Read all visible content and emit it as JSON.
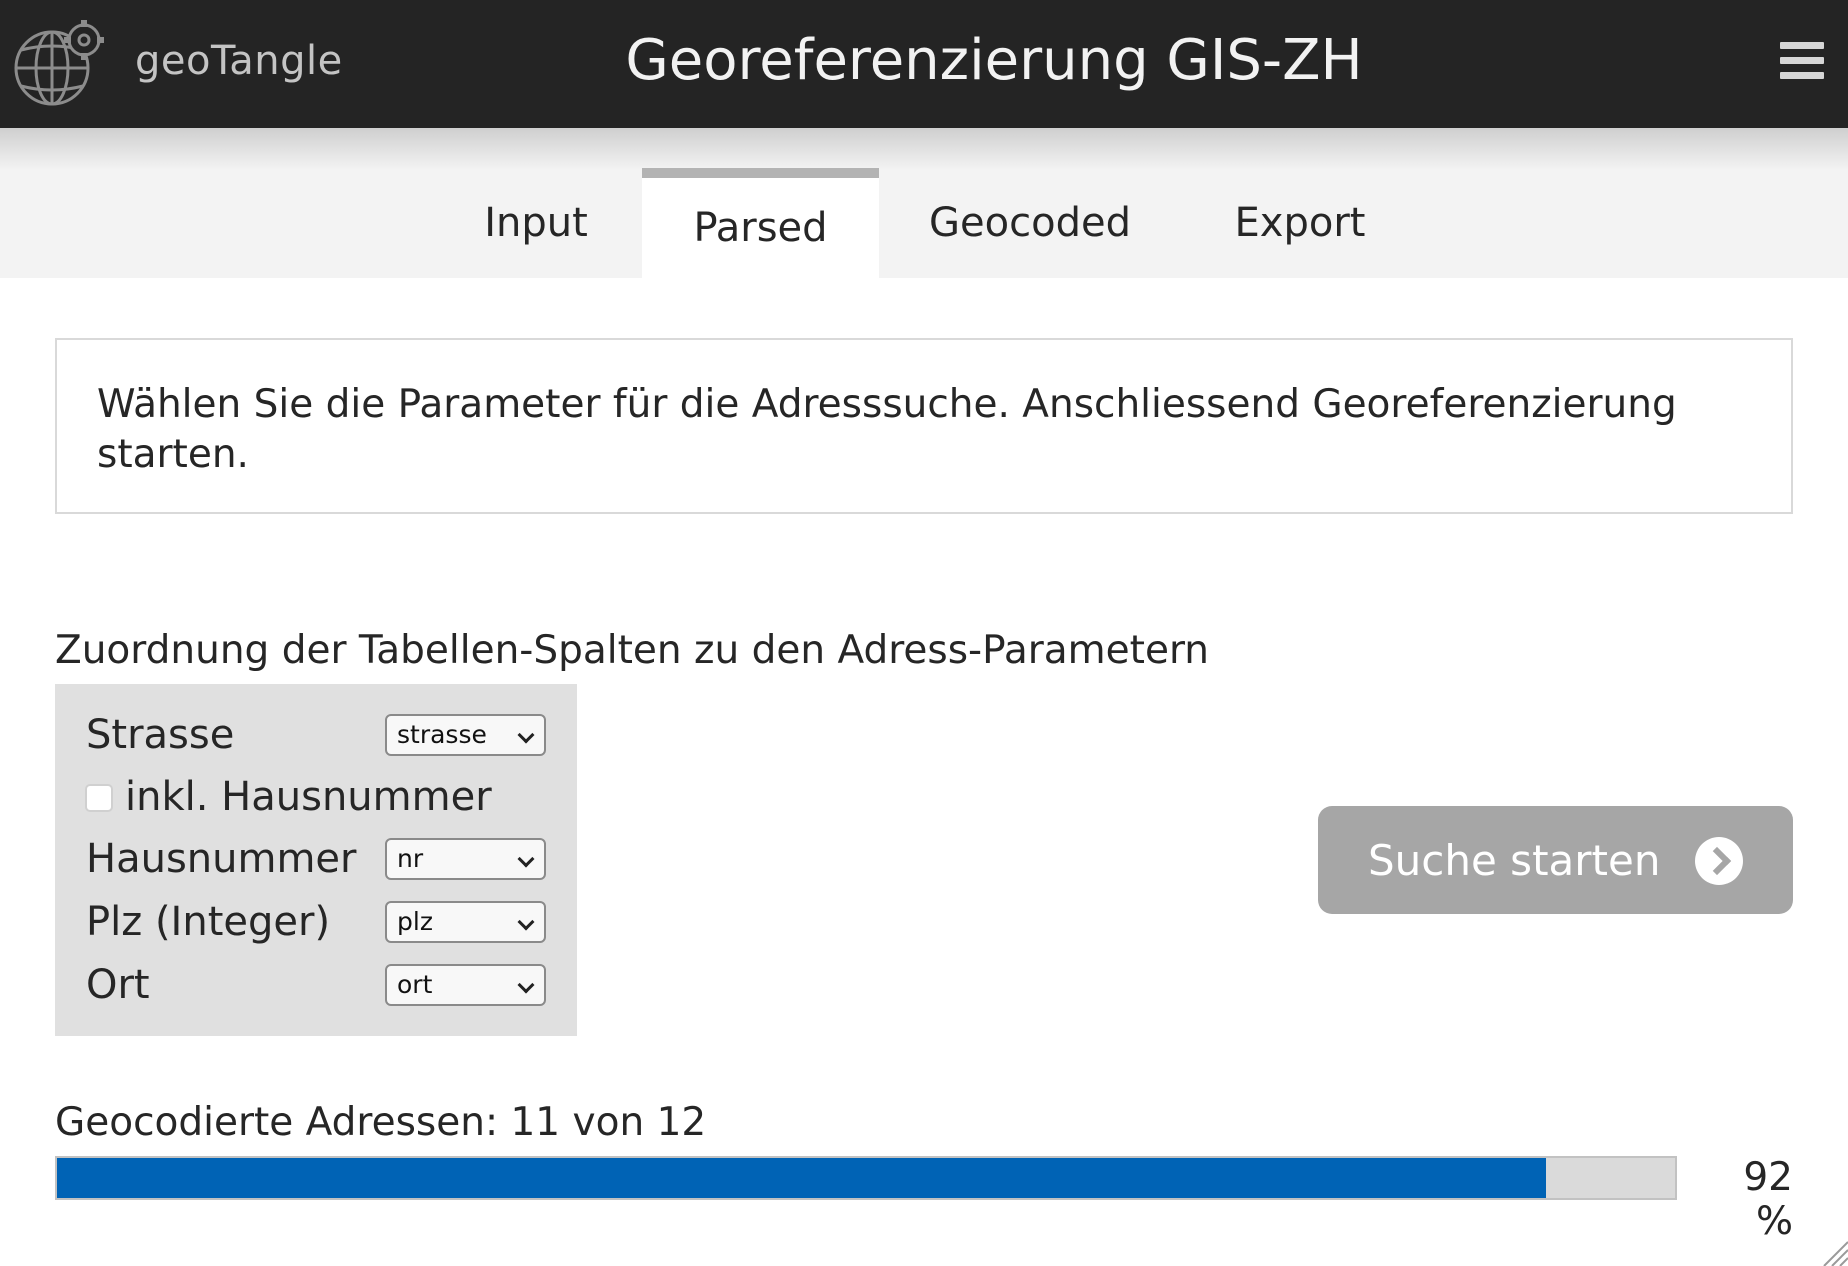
{
  "header": {
    "logo_text": "geoTangle",
    "title": "Georeferenzierung GIS-ZH",
    "menu_icon": "hamburger-menu-icon"
  },
  "tabs": [
    {
      "label": "Input",
      "active": false
    },
    {
      "label": "Parsed",
      "active": true
    },
    {
      "label": "Geocoded",
      "active": false
    },
    {
      "label": "Export",
      "active": false
    }
  ],
  "info": {
    "text": "Wählen Sie die Parameter für die Adresssuche. Anschliessend Georeferenzierung starten."
  },
  "mapping": {
    "heading": "Zuordnung der Tabellen-Spalten zu den Adress-Parametern",
    "strasse_label": "Strasse",
    "strasse_value": "strasse",
    "hausnummer_checkbox_label": "inkl. Hausnummer",
    "hausnummer_checkbox_checked": false,
    "hausnummer_label": "Hausnummer",
    "hausnummer_value": "nr",
    "plz_label": "Plz (Integer)",
    "plz_value": "plz",
    "ort_label": "Ort",
    "ort_value": "ort"
  },
  "search_button": {
    "label": "Suche starten",
    "icon": "chevron-circle-right-icon"
  },
  "progress": {
    "label": "Geocodierte Adressen: 11 von 12",
    "percent_text": "92 %",
    "percent": 92
  },
  "colors": {
    "header_bg": "#242424",
    "progress_fill": "#0063b5",
    "button_bg": "#a6a6a6"
  }
}
